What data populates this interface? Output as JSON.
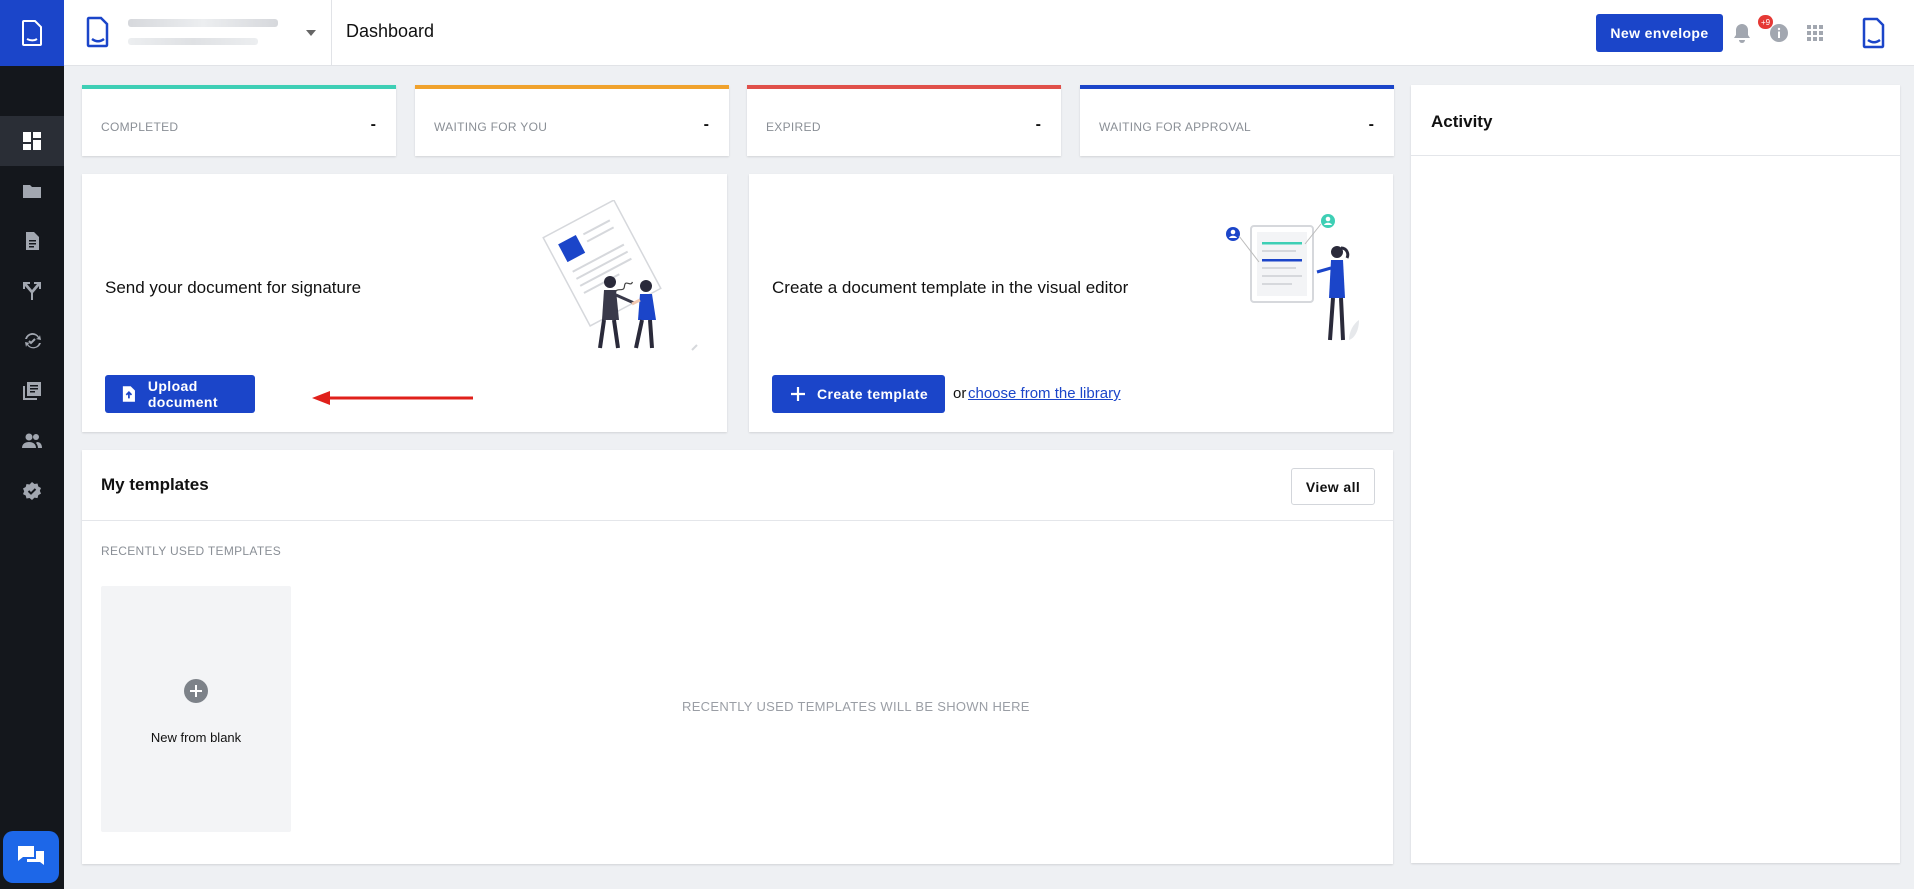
{
  "header": {
    "page_title": "Dashboard",
    "new_envelope_label": "New envelope",
    "notification_count": "+9"
  },
  "sidebar": {
    "items": [
      {
        "name": "dashboard",
        "icon": "dashboard-icon",
        "active": true
      },
      {
        "name": "folders",
        "icon": "folder-icon",
        "active": false
      },
      {
        "name": "documents",
        "icon": "document-icon",
        "active": false
      },
      {
        "name": "workflows",
        "icon": "fork-icon",
        "active": false
      },
      {
        "name": "sync",
        "icon": "sync-icon",
        "active": false
      },
      {
        "name": "library",
        "icon": "library-icon",
        "active": false
      },
      {
        "name": "contacts",
        "icon": "people-icon",
        "active": false
      },
      {
        "name": "settings",
        "icon": "badge-check-icon",
        "active": false
      }
    ]
  },
  "stats": [
    {
      "label": "COMPLETED",
      "value": "-",
      "color": "#3ecfb5"
    },
    {
      "label": "WAITING FOR YOU",
      "value": "-",
      "color": "#f0a22c"
    },
    {
      "label": "EXPIRED",
      "value": "-",
      "color": "#e0504a"
    },
    {
      "label": "WAITING FOR APPROVAL",
      "value": "-",
      "color": "#1b45c9"
    }
  ],
  "send_card": {
    "title": "Send your document for signature",
    "button_label": "Upload document"
  },
  "template_card": {
    "title": "Create a document template in the visual editor",
    "button_label": "Create template",
    "or_text": "or",
    "library_link": "choose from the library"
  },
  "templates": {
    "title": "My templates",
    "view_all_label": "View all",
    "recent_label": "RECENTLY USED TEMPLATES",
    "new_blank_label": "New from blank",
    "empty_message": "RECENTLY USED TEMPLATES WILL BE SHOWN HERE"
  },
  "activity": {
    "title": "Activity"
  },
  "colors": {
    "brand": "#1b45c9",
    "sidebar_bg": "#14171c",
    "annotation_arrow": "#e0201b"
  }
}
